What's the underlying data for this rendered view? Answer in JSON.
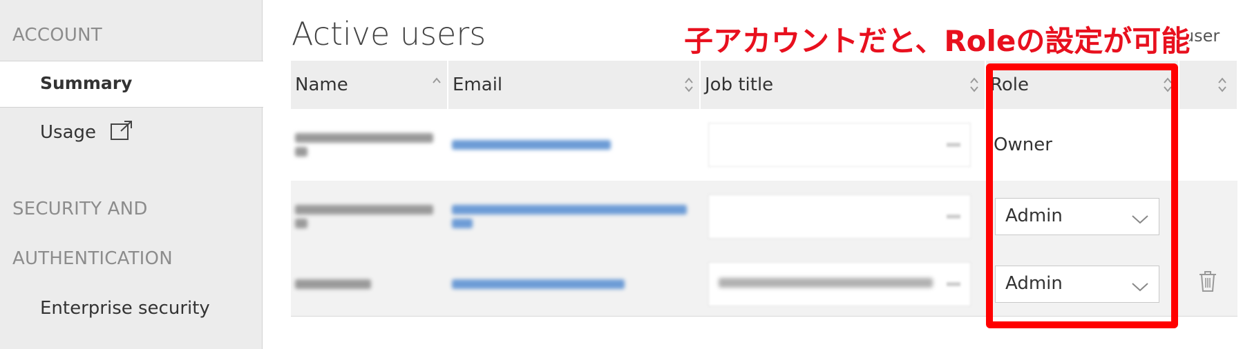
{
  "sidebar": {
    "section_account": "ACCOUNT",
    "item_summary": "Summary",
    "item_usage": "Usage",
    "section_security_1": "SECURITY AND",
    "section_security_2": "AUTHENTICATION",
    "item_enterprise": "Enterprise security"
  },
  "main": {
    "title": "Active users",
    "add_user_label": "d user"
  },
  "annotation": {
    "text": "子アカウントだと、Roleの設定が可能",
    "color": "#e8101e",
    "box_color": "#ff0000"
  },
  "table": {
    "headers": [
      "Name",
      "Email",
      "Job title",
      "Role",
      ""
    ],
    "rows": [
      {
        "role_text": "Owner"
      },
      {
        "role_select": "Admin"
      },
      {
        "role_select": "Admin"
      }
    ]
  },
  "icons": [
    "external-link-icon",
    "sort-icon",
    "chevron-down-icon",
    "trash-icon"
  ]
}
